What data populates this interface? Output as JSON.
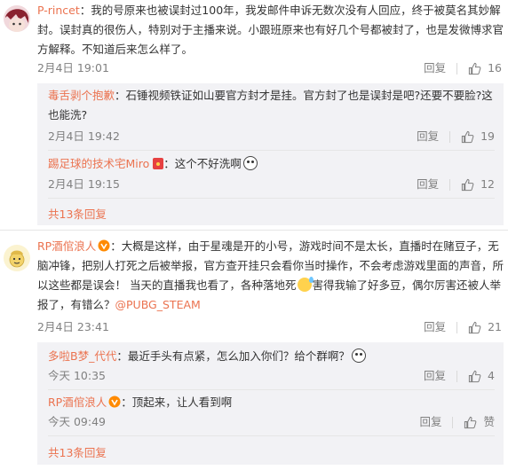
{
  "comments": [
    {
      "user": "P-rincet",
      "text": "：我的号原来也被误封过100年，我发邮件申诉无数次没有人回应，终于被莫名其妙解封。误封真的很伤人，特别对于主播来说。小跟班原来也有好几个号都被封了，也是发微博求官方解释。不知道后来怎么样了。",
      "time": "2月4日 19:01",
      "reply_label": "回复",
      "likes": "16",
      "replies": [
        {
          "user": "毒舌剥个抱歉",
          "text": "：石锤视频铁证如山要官方封才是挂。官方封了也是误封是吧?还要不要脸?这也能洗?",
          "time": "2月4日 19:42",
          "reply_label": "回复",
          "likes": "19"
        },
        {
          "user": "踢足球的技术宅Miro",
          "text": "：这个不好洗啊",
          "time": "2月4日 19:15",
          "reply_label": "回复",
          "likes": "12"
        }
      ],
      "more_replies": "共13条回复"
    },
    {
      "user": "RP酒倌浪人",
      "text_part1": "：大概是这样，由于星魂是开的小号，游戏时间不是太长，直播时在赌豆子，无脑冲锋，把别人打死之后被举报，官方查开挂只会看你当时操作，不会考虑游戏里面的声音，所以这些都是误会！ 当天的直播我也看了，各种落地死",
      "text_part2": "害得我输了好多豆，偶尔厉害还被人举报了，有错么？",
      "mention": "@PUBG_STEAM",
      "time": "2月4日 23:41",
      "reply_label": "回复",
      "likes": "21",
      "replies": [
        {
          "user": "多啦B梦_代代",
          "text": "：最近手头有点紧，怎么加入你们？给个群啊？",
          "time": "今天 10:35",
          "reply_label": "回复",
          "likes": "4"
        },
        {
          "user": "RP酒倌浪人",
          "text": "：顶起来，让人看到啊",
          "time": "今天 09:49",
          "reply_label": "回复",
          "likes": "赞"
        }
      ],
      "more_replies": "共13条回复"
    }
  ],
  "icons": {
    "like": "thumbs-up-icon",
    "vip": "vip-badge-icon",
    "emoji": "emoji-icon"
  },
  "colors": {
    "link": "#eb7350",
    "meta": "#808080",
    "sub_bg": "#f2f2f5"
  }
}
